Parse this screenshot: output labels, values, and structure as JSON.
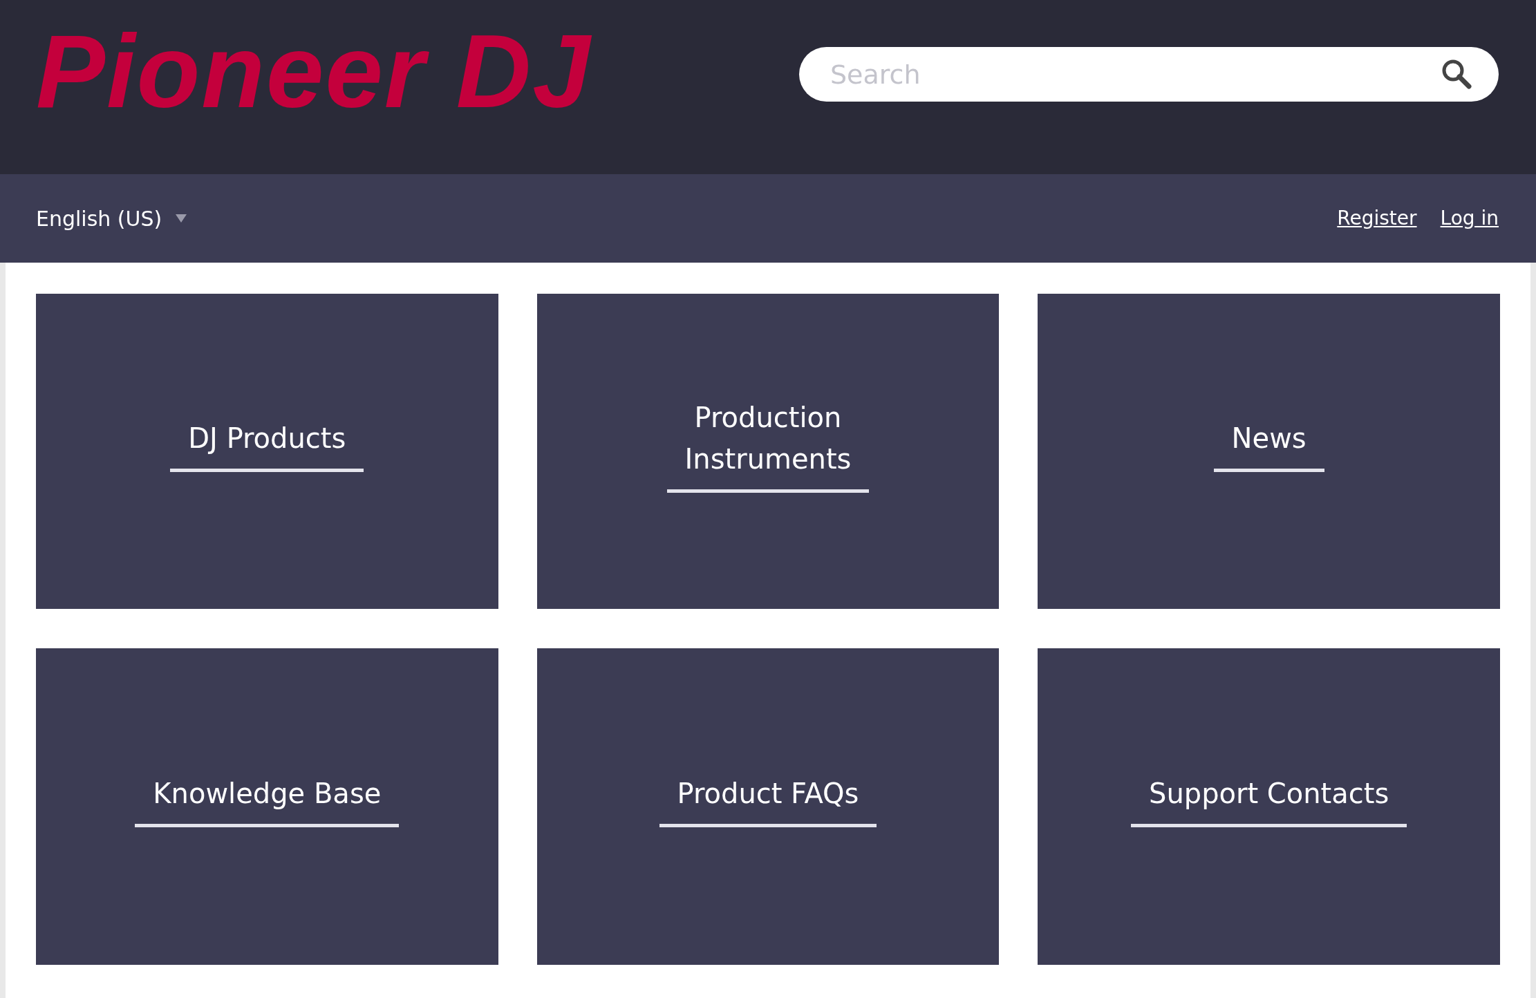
{
  "header": {
    "logo": "Pioneer DJ",
    "search": {
      "placeholder": "Search"
    }
  },
  "nav": {
    "language": "English (US)",
    "links": [
      "Register",
      "Log in"
    ]
  },
  "tiles": [
    {
      "lines": [
        "DJ Products"
      ]
    },
    {
      "lines": [
        "Production",
        "Instruments"
      ]
    },
    {
      "lines": [
        "News"
      ]
    },
    {
      "lines": [
        "Knowledge Base"
      ]
    },
    {
      "lines": [
        "Product FAQs"
      ]
    },
    {
      "lines": [
        "Support Contacts"
      ]
    }
  ]
}
